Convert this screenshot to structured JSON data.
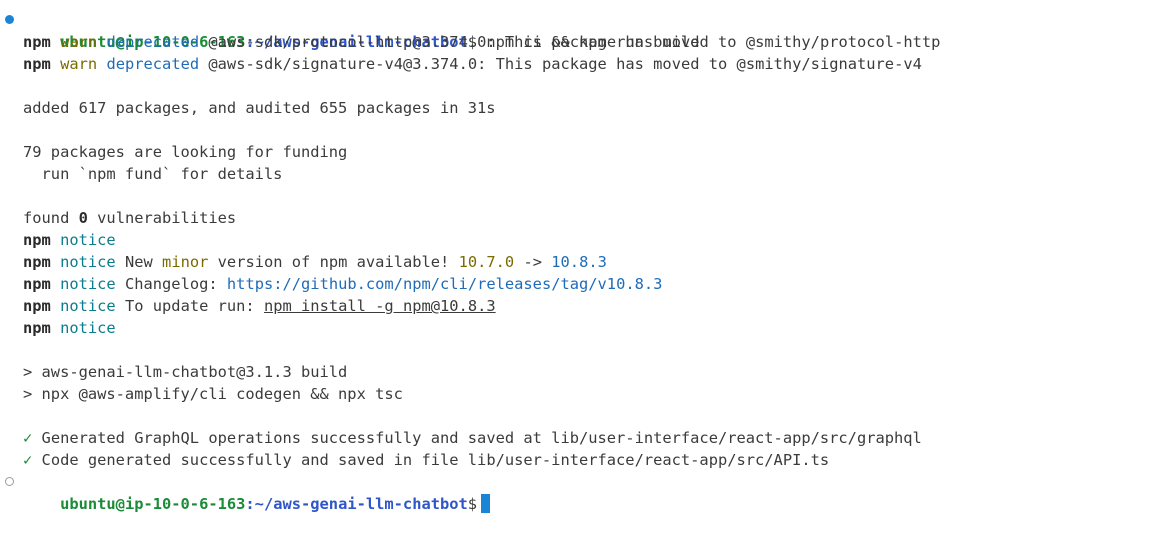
{
  "prompt": {
    "user_host": "ubuntu@ip-10-0-6-163",
    "path": ":~/aws-genai-llm-chatbot",
    "symbol": "$"
  },
  "command": " npm ci && npm run build",
  "warn_lines": [
    {
      "npm": "npm",
      "level": "warn",
      "tag": "deprecated",
      "text": " @aws-sdk/protocol-http@3.374.0: This package has moved to @smithy/protocol-http"
    },
    {
      "npm": "npm",
      "level": "warn",
      "tag": "deprecated",
      "text": " @aws-sdk/signature-v4@3.374.0: This package has moved to @smithy/signature-v4"
    }
  ],
  "added": "added 617 packages, and audited 655 packages in 31s",
  "funding": "79 packages are looking for funding",
  "funding_hint": "  run `npm fund` for details",
  "found": {
    "prefix": "found ",
    "count": "0",
    "suffix": " vulnerabilities"
  },
  "notice": {
    "npm": "npm",
    "label": "notice",
    "update_prefix": " New ",
    "update_minor": "minor",
    "update_mid": " version of npm available! ",
    "old_version": "10.7.0",
    "arrow": " -> ",
    "new_version": "10.8.3",
    "changelog_label": " Changelog: ",
    "changelog_url": "https://github.com/npm/cli/releases/tag/v10.8.3",
    "update_run_label": " To update run: ",
    "update_run_cmd": "npm install -g npm@10.8.3"
  },
  "build_lines": [
    "> aws-genai-llm-chatbot@3.1.3 build",
    "> npx @aws-amplify/cli codegen && npx tsc"
  ],
  "success_lines": [
    {
      "mark": "✓",
      "text": " Generated GraphQL operations successfully and saved at lib/user-interface/react-app/src/graphql"
    },
    {
      "mark": "✓",
      "text": " Code generated successfully and saved in file lib/user-interface/react-app/src/API.ts"
    }
  ],
  "colors": {
    "prompt_user": "#1a8b36",
    "prompt_path": "#2f56c9",
    "cursor": "#1a85d6",
    "notice": "#0b7d8c",
    "warn": "#7a6b00"
  }
}
